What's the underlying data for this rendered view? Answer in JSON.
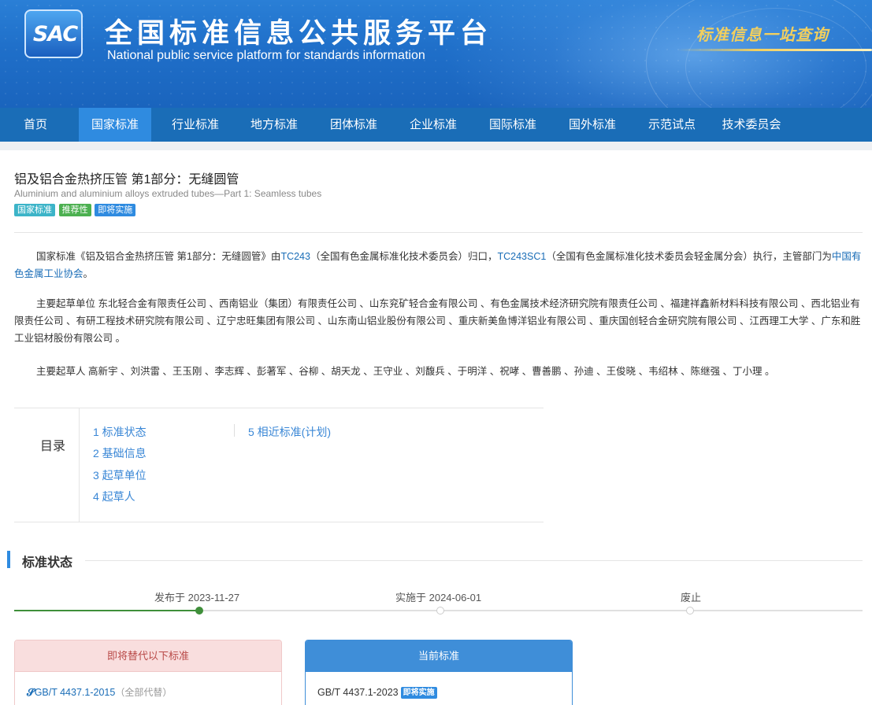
{
  "header": {
    "logo_text": "SAC",
    "title_cn": "全国标准信息公共服务平台",
    "title_en": "National public service platform  for standards information",
    "slogan": "标准信息一站查询"
  },
  "nav": {
    "items": [
      "首页",
      "国家标准",
      "行业标准",
      "地方标准",
      "团体标准",
      "企业标准",
      "国际标准",
      "国外标准",
      "示范试点",
      "技术委员会"
    ],
    "active": "国家标准"
  },
  "standard": {
    "title": "铝及铝合金热挤压管 第1部分：无缝圆管",
    "title_en": "Aluminium and aluminium alloys extruded tubes—Part 1: Seamless tubes",
    "tags": [
      {
        "label": "国家标准",
        "color": "#3cb4c8"
      },
      {
        "label": "推荐性",
        "color": "#4cb050"
      },
      {
        "label": "即将实施",
        "color": "#2f8be0"
      }
    ]
  },
  "intro": {
    "p1_a": "国家标准《铝及铝合金热挤压管 第1部分：无缝圆管》由",
    "tc1": "TC243",
    "p1_b": "（全国有色金属标准化技术委员会）归口，",
    "tc2": "TC243SC1",
    "p1_c": "（全国有色金属标准化技术委员会轻金属分会）执行，主管部门为",
    "dept": "中国有色金属工业协会",
    "p1_d": "。",
    "drafters_units": "主要起草单位 东北轻合金有限责任公司 、西南铝业（集团）有限责任公司 、山东兖矿轻合金有限公司 、有色金属技术经济研究院有限责任公司 、福建祥鑫新材料科技有限公司 、西北铝业有限责任公司 、有研工程技术研究院有限公司 、辽宁忠旺集团有限公司 、山东南山铝业股份有限公司 、重庆新美鱼博洋铝业有限公司 、重庆国创轻合金研究院有限公司 、江西理工大学 、广东和胜工业铝材股份有限公司 。",
    "drafters_people": "主要起草人 高新宇 、刘洪雷 、王玉刚 、李志辉 、彭著军 、谷柳 、胡天龙 、王守业 、刘馥兵 、于明洋 、祝哮 、曹善鹏 、孙迪 、王俊晓 、韦绍林 、陈继强 、丁小理 。"
  },
  "toc": {
    "label": "目录",
    "items": [
      "1 标准状态",
      "2 基础信息",
      "3 起草单位",
      "4 起草人",
      "5 相近标准(计划)"
    ]
  },
  "status": {
    "heading": "标准状态",
    "timeline": {
      "published": "发布于 2023-11-27",
      "implemented": "实施于 2024-06-01",
      "abolished": "废止"
    },
    "replace_card": {
      "title": "即将替代以下标准",
      "std": "GB/T 4437.1-2015",
      "note": "（全部代替）"
    },
    "current_card": {
      "title": "当前标准",
      "std": "GB/T 4437.1-2023",
      "badge": "即将实施"
    },
    "colors": {
      "progress": "#3f8f3a",
      "replace_head_bg": "#f9dede",
      "replace_head_text": "#b94a48",
      "current_head_bg": "#3f8ed8"
    }
  }
}
